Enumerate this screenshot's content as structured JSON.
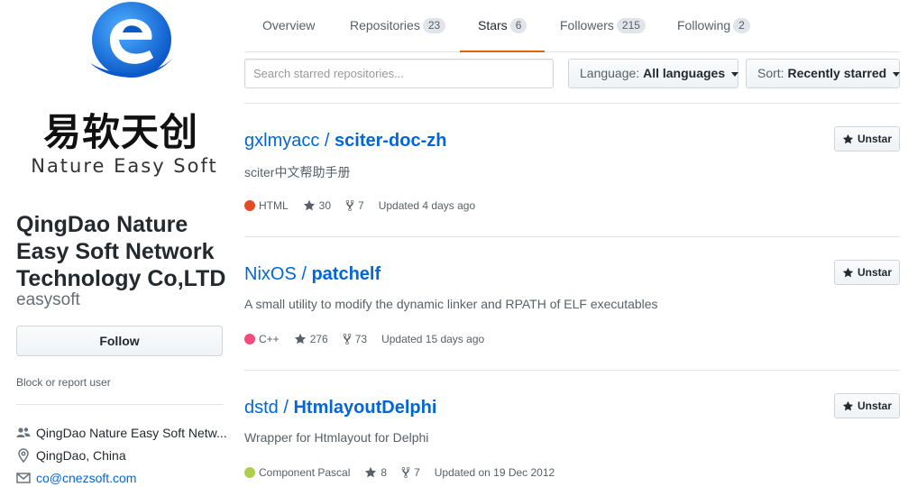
{
  "profile": {
    "logo_cn": "易软天创",
    "logo_en": "Nature Easy Soft",
    "name": "QingDao Nature Easy Soft Network Technology Co,LTD",
    "login": "easysoft",
    "follow_label": "Follow",
    "block_label": "Block or report user",
    "company": "QingDao Nature Easy Soft Netw...",
    "location": "QingDao, China",
    "email": "co@cnezsoft.com",
    "icons": {
      "company": "people-icon",
      "location": "location-pin-icon",
      "email": "mail-icon"
    }
  },
  "tabs": [
    {
      "label": "Overview",
      "count": null,
      "selected": false
    },
    {
      "label": "Repositories",
      "count": "23",
      "selected": false
    },
    {
      "label": "Stars",
      "count": "6",
      "selected": true
    },
    {
      "label": "Followers",
      "count": "215",
      "selected": false
    },
    {
      "label": "Following",
      "count": "2",
      "selected": false
    }
  ],
  "filters": {
    "search_placeholder": "Search starred repositories...",
    "language_prefix": "Language:",
    "language_value": "All languages",
    "sort_prefix": "Sort:",
    "sort_value": "Recently starred"
  },
  "repos": [
    {
      "owner": "gxlmyacc",
      "sep": " / ",
      "name": "sciter-doc-zh",
      "description": "sciter中文帮助手册",
      "language": "HTML",
      "language_color": "#e34c26",
      "stars": "30",
      "forks": "7",
      "updated": "Updated 4 days ago",
      "unstar_label": "Unstar"
    },
    {
      "owner": "NixOS",
      "sep": " / ",
      "name": "patchelf",
      "description": "A small utility to modify the dynamic linker and RPATH of ELF executables",
      "language": "C++",
      "language_color": "#f34b7d",
      "stars": "276",
      "forks": "73",
      "updated": "Updated 15 days ago",
      "unstar_label": "Unstar"
    },
    {
      "owner": "dstd",
      "sep": " / ",
      "name": "HtmlayoutDelphi",
      "description": "Wrapper for Htmlayout for Delphi",
      "language": "Component Pascal",
      "language_color": "#b0ce4e",
      "stars": "8",
      "forks": "7",
      "updated": "Updated on 19 Dec 2012",
      "unstar_label": "Unstar"
    }
  ],
  "colors": {
    "link": "#0366d6",
    "tab_underline": "#e36209",
    "logo_blue": "#1e73d8"
  }
}
